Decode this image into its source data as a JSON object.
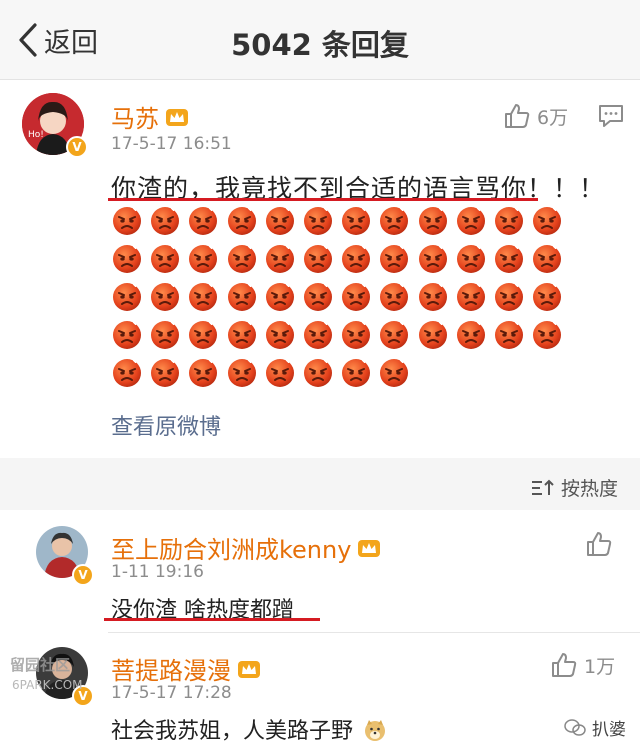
{
  "nav": {
    "back_label": "返回",
    "title": "5042 条回复"
  },
  "post": {
    "username": "马苏",
    "time": "17-5-17 16:51",
    "likes": "6万",
    "text": "你渣的，我竟找不到合适的语言骂你！！！",
    "emoji_count": 56,
    "view_original": "查看原微博"
  },
  "sort": {
    "label": "按热度"
  },
  "comments": [
    {
      "username": "至上励合刘洲成kenny",
      "time": "1-11 19:16",
      "likes": "",
      "text": "没你渣 啥热度都蹭"
    },
    {
      "username": "菩提路漫漫",
      "time": "17-5-17 17:28",
      "likes": "1万",
      "text": "社会我苏姐，人美路子野"
    }
  ],
  "watermark": {
    "text": "留园社区",
    "url": "6PARK.COM"
  },
  "brand": {
    "label": "扒婆"
  },
  "colors": {
    "username": "#e6700a",
    "underline": "#d51b22",
    "link": "#5a6d8e",
    "vip": "#f3a51b"
  }
}
